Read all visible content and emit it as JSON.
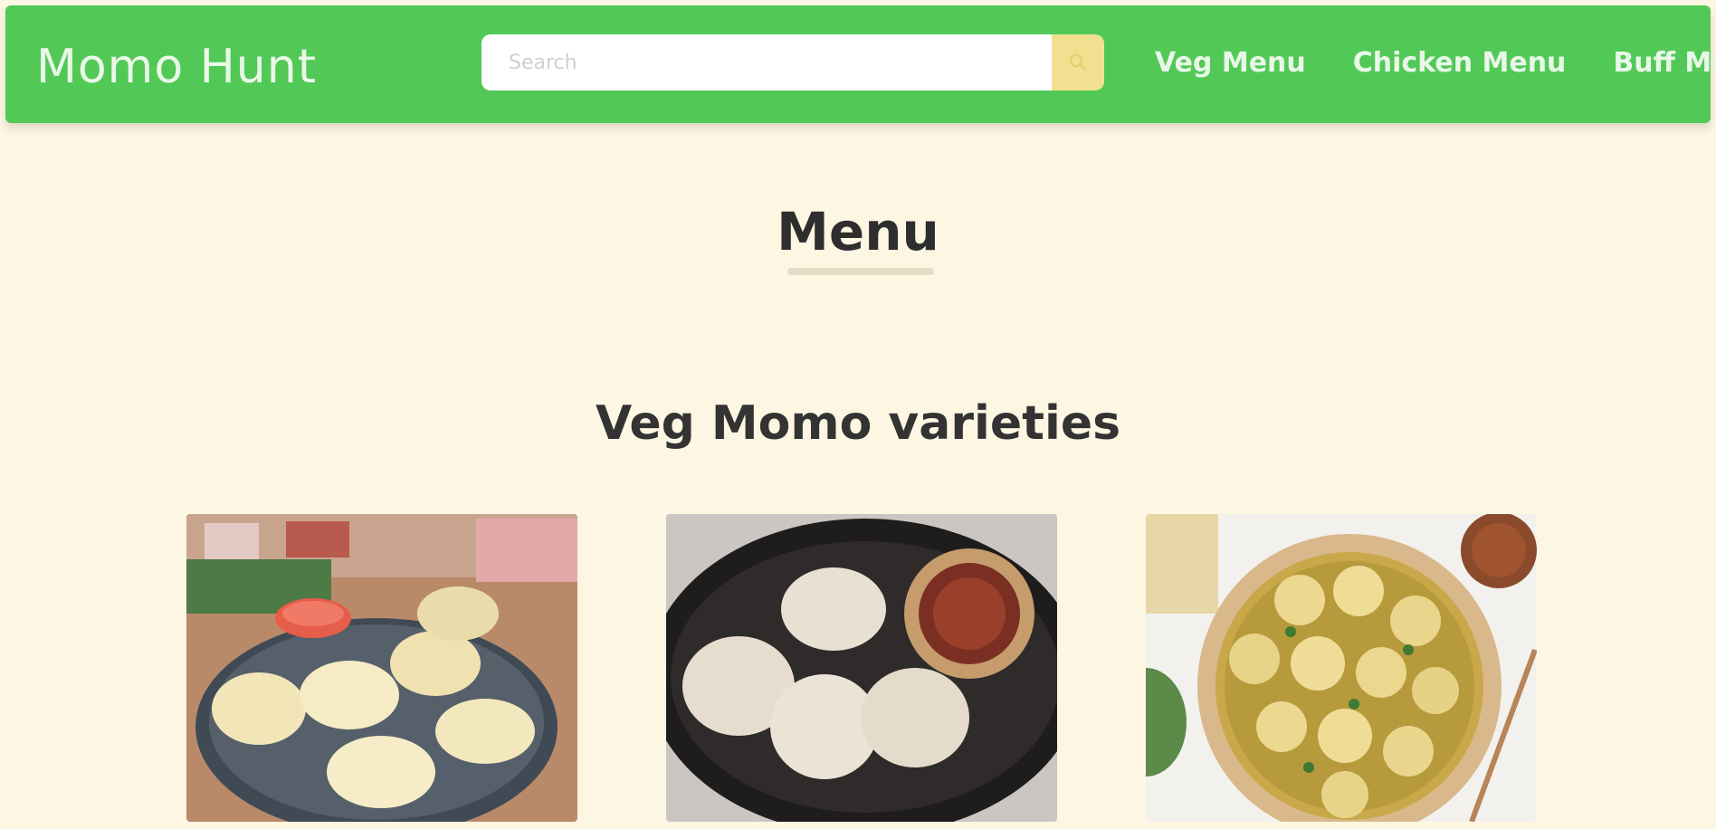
{
  "header": {
    "brand": "Momo Hunt",
    "search": {
      "placeholder": "Search",
      "value": "",
      "button_icon": "search-icon"
    },
    "nav": [
      {
        "label": "Veg Menu"
      },
      {
        "label": "Chicken Menu"
      },
      {
        "label": "Buff Menu"
      }
    ]
  },
  "main": {
    "title": "Menu",
    "sections": [
      {
        "title": "Veg Momo varieties",
        "items": [
          {
            "image": "steamed momos on a plate with red dipping sauce"
          },
          {
            "image": "pan-fried momos on a black plate with chutney bowl"
          },
          {
            "image": "jhol momo soup in a bowl with greens"
          }
        ]
      }
    ]
  },
  "colors": {
    "navbar": "#52c957",
    "background": "#fdf6e2",
    "search_button": "#f1e08f",
    "text_dark": "#2e2e2e"
  }
}
